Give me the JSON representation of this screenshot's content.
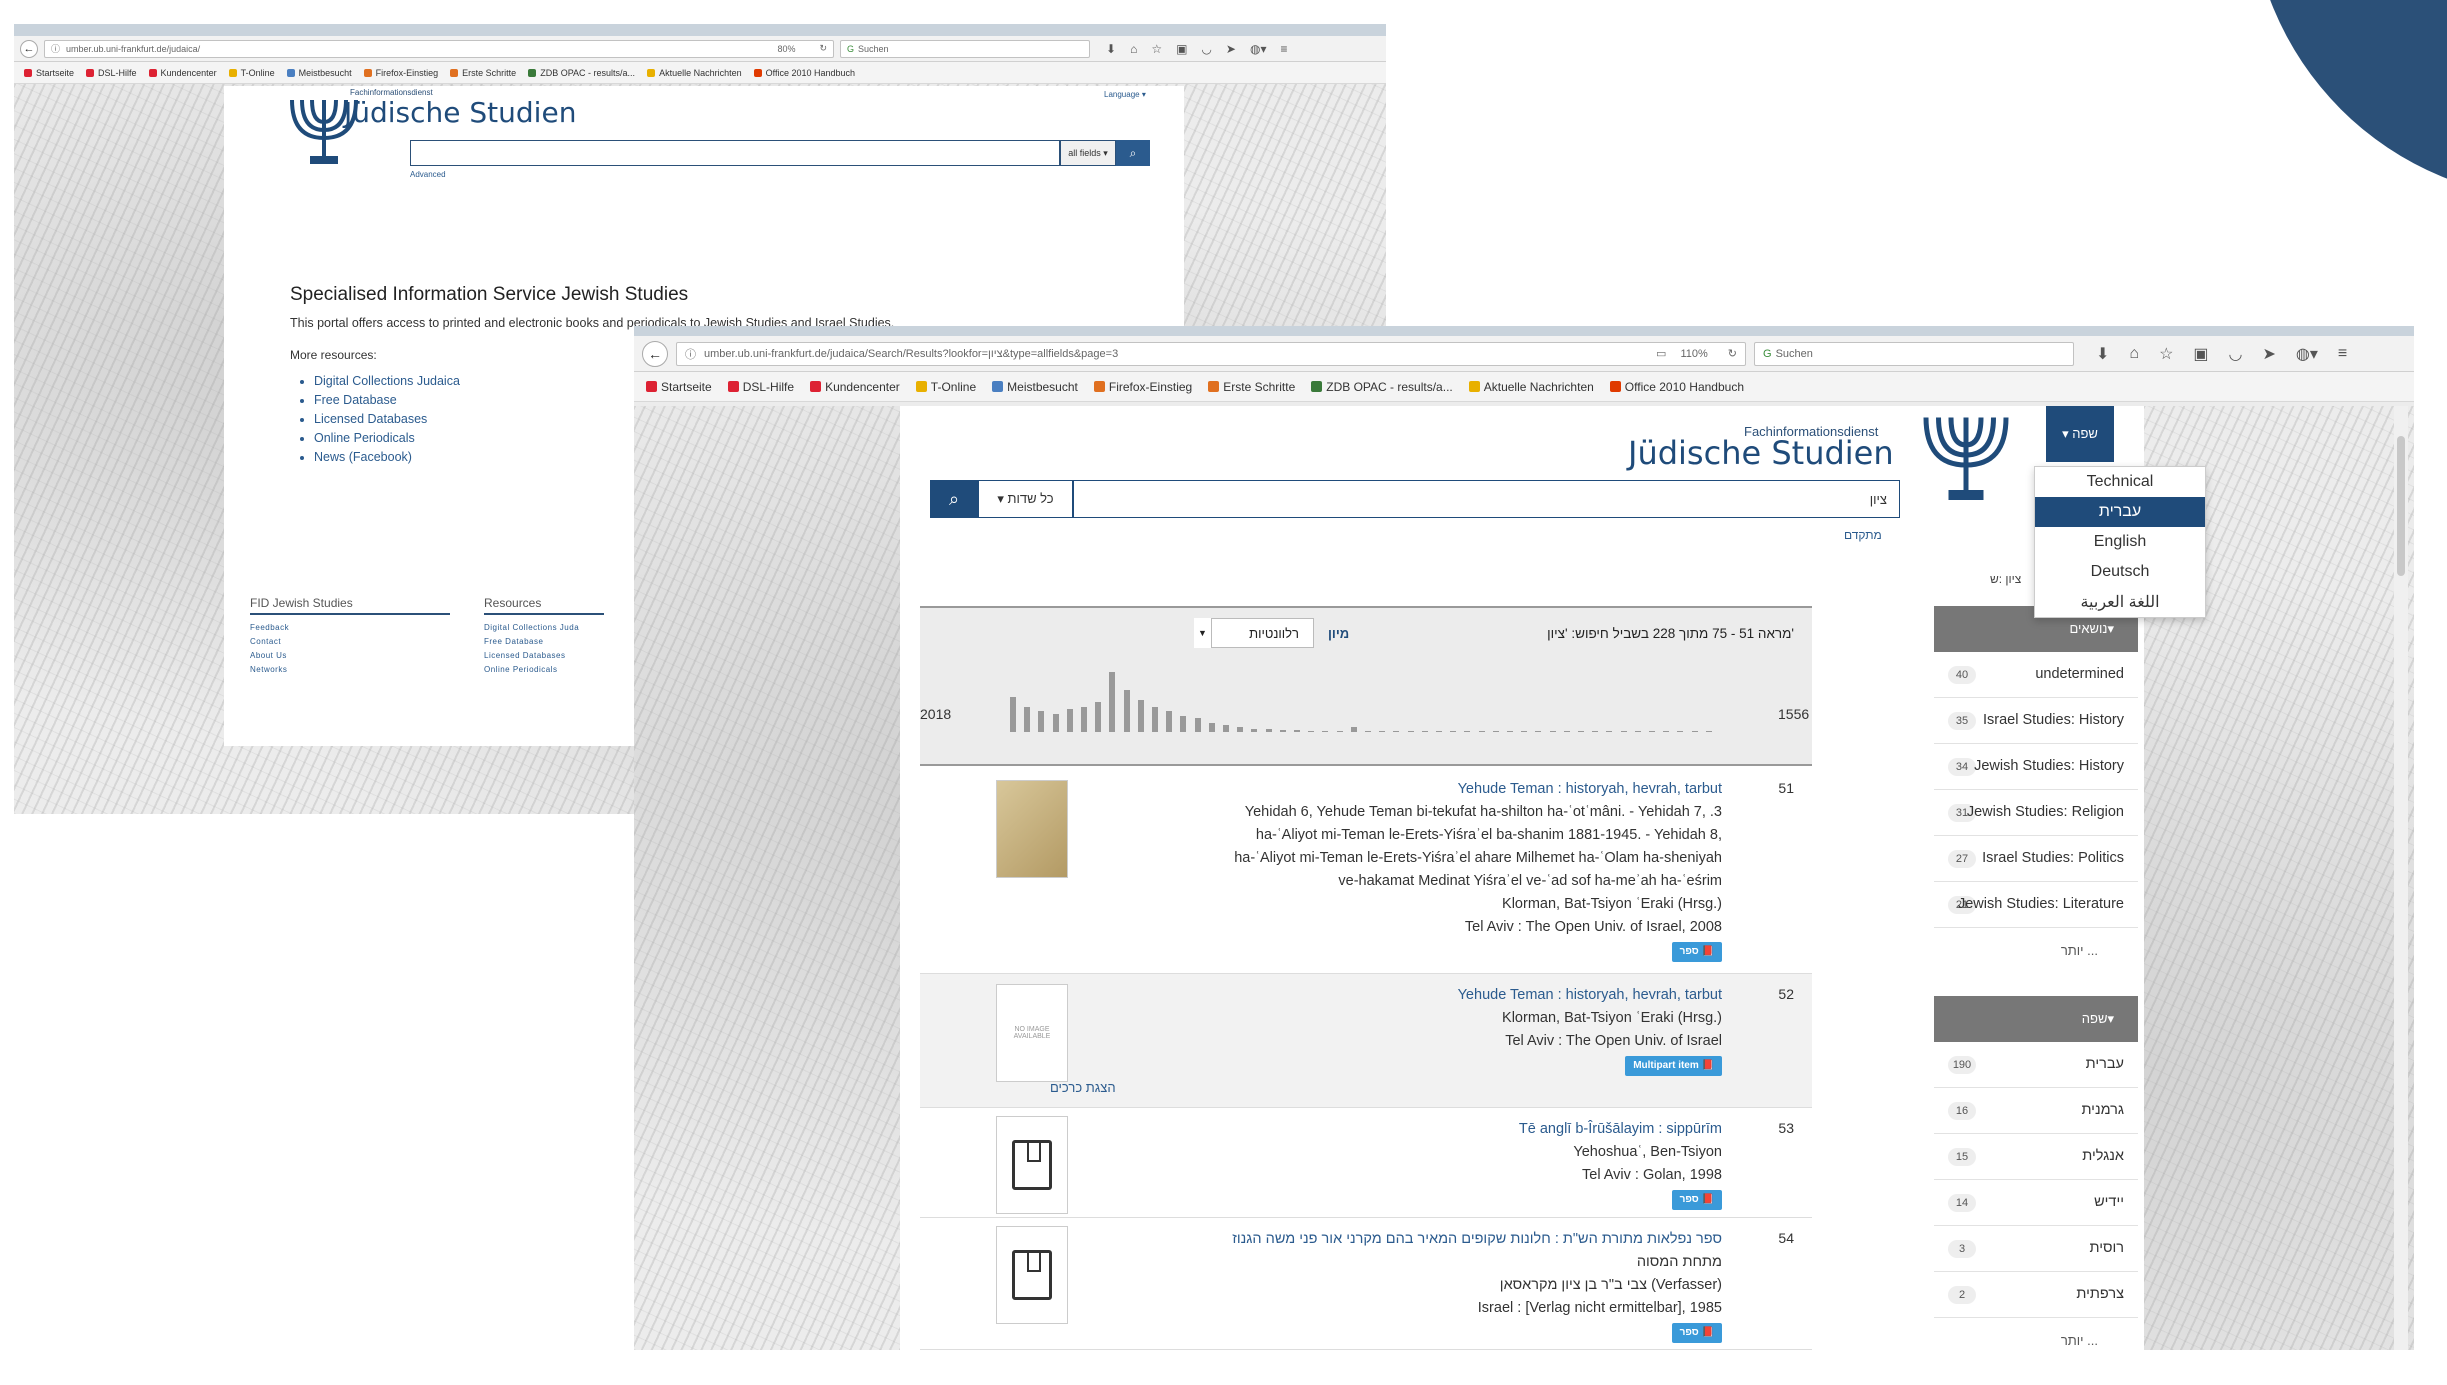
{
  "colors": {
    "accent": "#1f4b7a",
    "link": "#2b5b8e",
    "corner": "#2b5078",
    "badge": "#3a9ad9"
  },
  "window1": {
    "url": "umber.ub.uni-frankfurt.de/judaica/",
    "zoom": "80%",
    "search_placeholder": "Suchen",
    "bookmarks": [
      "Startseite",
      "DSL-Hilfe",
      "Kundencenter",
      "T-Online",
      "Meistbesucht",
      "Firefox-Einstieg",
      "Erste Schritte",
      "ZDB OPAC - results/a...",
      "Aktuelle Nachrichten",
      "Office 2010 Handbuch"
    ],
    "brand_small": "Fachinformationsdienst",
    "brand_big": "Jüdische Studien",
    "language": "Language ▾",
    "search_scope": "all fields ▾",
    "advanced": "Advanced",
    "heading": "Specialised Information Service Jewish Studies",
    "intro": "This portal offers access to printed and electronic books and periodicals to Jewish Studies and Israel Studies.",
    "more_resources": "More resources:",
    "resources": [
      "Digital Collections Judaica",
      "Free Database",
      "Licensed Databases",
      "Online Periodicals",
      "News (Facebook)"
    ],
    "footer_col1": {
      "heading": "FID Jewish Studies",
      "items": [
        "Feedback",
        "Contact",
        "About Us",
        "Networks"
      ]
    },
    "footer_col2": {
      "heading": "Resources",
      "items": [
        "Digital Collections Juda",
        "Free Database",
        "Licensed Databases",
        "Online Periodicals"
      ]
    }
  },
  "window2": {
    "url": "umber.ub.uni-frankfurt.de/judaica/Search/Results?lookfor=ציון&type=allfields&page=3",
    "zoom": "110%",
    "search_placeholder": "Suchen",
    "bookmarks": [
      "Startseite",
      "DSL-Hilfe",
      "Kundencenter",
      "T-Online",
      "Meistbesucht",
      "Firefox-Einstieg",
      "Erste Schritte",
      "ZDB OPAC - results/a...",
      "Aktuelle Nachrichten",
      "Office 2010 Handbuch"
    ],
    "brand_small": "Fachinformationsdienst",
    "brand_big": "Jüdische Studien",
    "lang_button": "▾ שפה",
    "lang_options": [
      "Technical",
      "עברית",
      "English",
      "Deutsch",
      "اللغة العربية"
    ],
    "lang_active_index": 1,
    "search_scope": "▾ כל שדות",
    "search_value": "ציון",
    "advanced": "מתקדם",
    "crumb": "ציון :ש",
    "result_count": "מראה 51 - 75 מתוך 228 בשביל חיפוש: 'ציון'",
    "sort_label": "מיון",
    "sort_value": "רלוונטיות",
    "hist_left": "2018",
    "hist_right": "1556",
    "hist_values": [
      30,
      22,
      18,
      16,
      20,
      22,
      26,
      52,
      36,
      28,
      22,
      18,
      14,
      12,
      8,
      6,
      4,
      3,
      3,
      2,
      2,
      1,
      1,
      1,
      4,
      1,
      0,
      0,
      1,
      0,
      0,
      0,
      0,
      1,
      0,
      0,
      0,
      0,
      0,
      0,
      0,
      0,
      0,
      1,
      0,
      0,
      0,
      0,
      0,
      0
    ],
    "records": [
      {
        "num": "51",
        "title": "Yehude Teman : historyah, hevrah, tarbut",
        "lines": [
          "Yehidah 6, Yehude Teman bi-tekufat ha-shilton ha-ʿotʿmâni. - Yehidah 7, .3",
          "ha-ʿAliyot mi-Teman le-Erets-Yiśraʾel ba-shanim 1881-1945. - Yehidah 8,",
          "ha-ʿAliyot mi-Teman le-Erets-Yiśraʾel ahare Milhemet ha-ʿOlam ha-sheniyah",
          "ve-hakamat Medinat Yiśraʾel ve-ʿad sof ha-meʾah ha-ʿeśrim",
          "Klorman, Bat-Tsiyon ʿEraki (Hrsg.)",
          "Tel Aviv : The Open Univ. of Israel, 2008"
        ],
        "badge": "ספר 📕"
      },
      {
        "num": "52",
        "title": "Yehude Teman : historyah, hevrah, tarbut",
        "lines": [
          "Klorman, Bat-Tsiyon ʿEraki (Hrsg.)",
          "Tel Aviv : The Open Univ. of Israel"
        ],
        "badge": "Multipart item 📕",
        "extra": "הצגת כרכים",
        "thumb_text": "NO IMAGE AVAILABLE"
      },
      {
        "num": "53",
        "title": "Tē anglī b-Îrūšālayim : sippūrīm",
        "lines": [
          "Yehoshuaʿ, Ben-Tsiyon",
          "Tel Aviv : Golan, 1998"
        ],
        "badge": "ספר 📕"
      },
      {
        "num": "54",
        "title": "ספר נפלאות מתורת הש\"ת : חלונות שקופים המאיר בהם מקרני אור פני משה הגנוז",
        "lines": [
          "מתחת המסוה",
          "צבי ב\"ר בן ציון מקראסאן (Verfasser)",
          "Israel : [Verlag nicht ermittelbar], 1985"
        ],
        "badge": "ספר 📕"
      }
    ],
    "facet_topics": {
      "heading": "נושאים▾",
      "items": [
        {
          "count": "40",
          "label": "undetermined"
        },
        {
          "count": "35",
          "label": "Israel Studies: History"
        },
        {
          "count": "34",
          "label": "Jewish Studies: History"
        },
        {
          "count": "31",
          "label": "Jewish Studies: Religion"
        },
        {
          "count": "27",
          "label": "Israel Studies: Politics"
        },
        {
          "count": "21",
          "label": "Jewish Studies: Literature"
        }
      ],
      "more": "יותר ..."
    },
    "facet_language": {
      "heading": "שפה▾",
      "items": [
        {
          "count": "190",
          "label": "עברית"
        },
        {
          "count": "16",
          "label": "גרמנית"
        },
        {
          "count": "15",
          "label": "אנגלית"
        },
        {
          "count": "14",
          "label": "יידיש"
        },
        {
          "count": "3",
          "label": "רוסית"
        },
        {
          "count": "2",
          "label": "צרפתית"
        }
      ],
      "more": "יותר ..."
    }
  }
}
